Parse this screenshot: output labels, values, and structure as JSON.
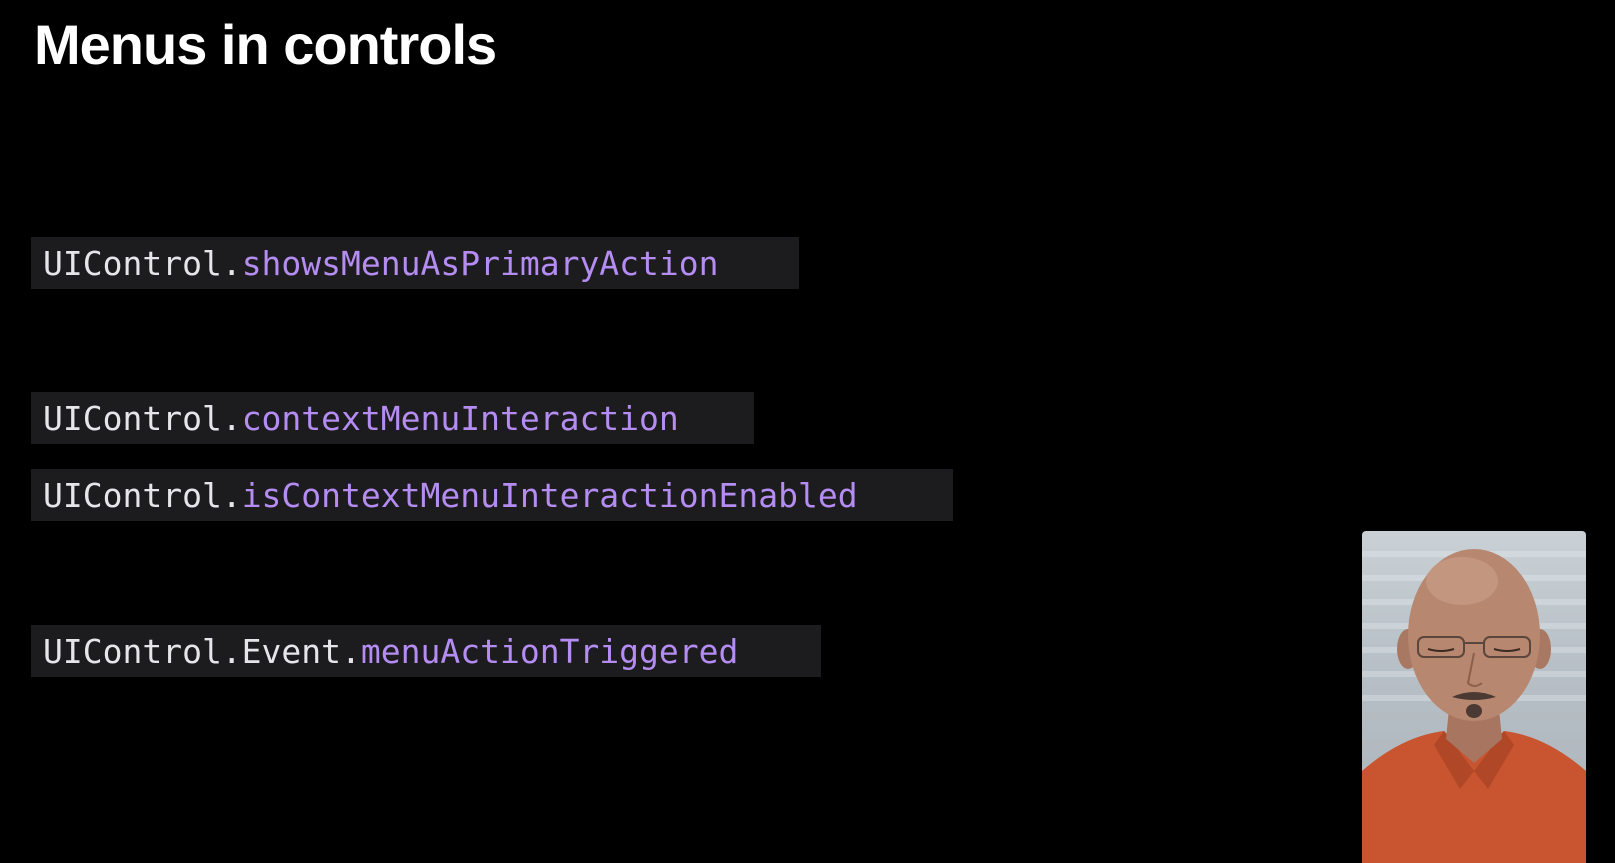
{
  "slide": {
    "title": "Menus in controls"
  },
  "code_lines": [
    {
      "prefix": "UIControl.",
      "member": "showsMenuAsPrimaryAction"
    },
    {
      "prefix": "UIControl.",
      "member": "contextMenuInteraction"
    },
    {
      "prefix": "UIControl.",
      "member": "isContextMenuInteractionEnabled"
    },
    {
      "prefix": "UIControl.Event.",
      "member": "menuActionTriggered"
    }
  ],
  "colors": {
    "background": "#000000",
    "code_background": "#1c1c1e",
    "code_plain": "#e5e5ea",
    "code_member": "#b48cf2"
  },
  "icons": {
    "presenter": "presenter-video-icon"
  }
}
